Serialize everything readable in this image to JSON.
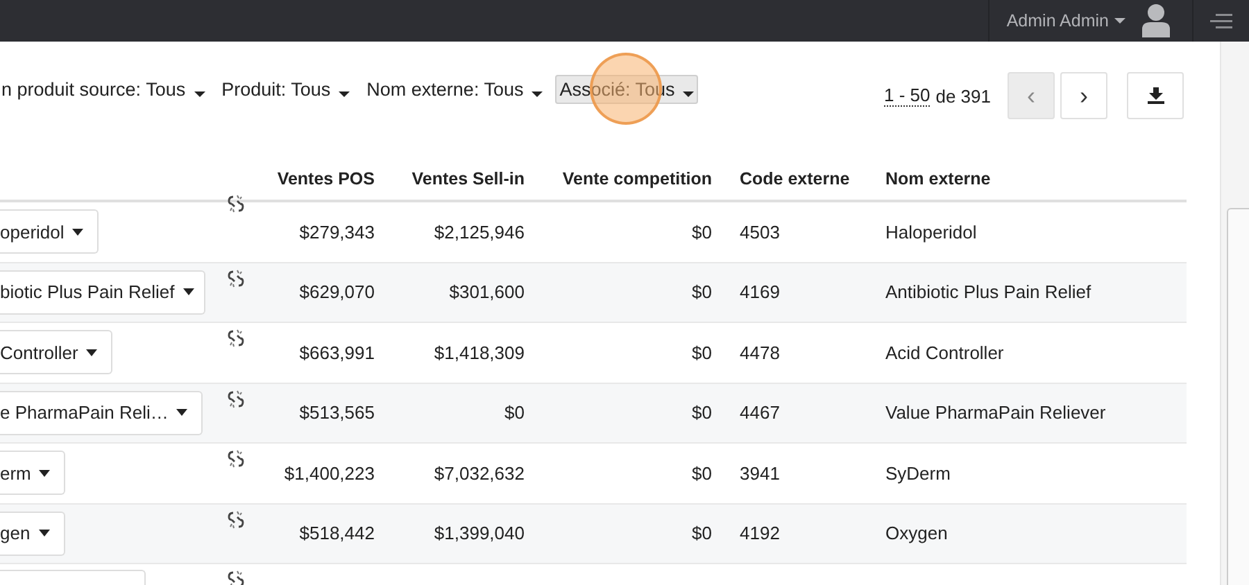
{
  "topbar": {
    "user": "Admin Admin"
  },
  "filters": [
    {
      "label": "n produit source: Tous",
      "highlighted": false
    },
    {
      "label": "Produit: Tous",
      "highlighted": false
    },
    {
      "label": "Nom externe: Tous",
      "highlighted": false
    },
    {
      "label": "Associé: Tous",
      "highlighted": true
    }
  ],
  "pagination": {
    "range": "1 - 50",
    "total": "de 391",
    "prev": "‹",
    "next": "›"
  },
  "table": {
    "columns": [
      "Ventes POS",
      "Ventes Sell-in",
      "Vente competition",
      "Code externe",
      "Nom externe"
    ],
    "rows": [
      {
        "kind": "full",
        "product": "operidol",
        "ventes_pos": "$279,343",
        "ventes_sell_in": "$2,125,946",
        "vente_competition": "$0",
        "code_externe": "4503",
        "nom_externe": "Haloperidol"
      },
      {
        "kind": "full",
        "product": "biotic Plus Pain Relief",
        "ventes_pos": "$629,070",
        "ventes_sell_in": "$301,600",
        "vente_competition": "$0",
        "code_externe": "4169",
        "nom_externe": "Antibiotic Plus Pain Relief"
      },
      {
        "kind": "full",
        "product": "Controller",
        "ventes_pos": "$663,991",
        "ventes_sell_in": "$1,418,309",
        "vente_competition": "$0",
        "code_externe": "4478",
        "nom_externe": "Acid Controller"
      },
      {
        "kind": "full",
        "product": "e PharmaPain Reli…",
        "ventes_pos": "$513,565",
        "ventes_sell_in": "$0",
        "vente_competition": "$0",
        "code_externe": "4467",
        "nom_externe": "Value PharmaPain Reliever"
      },
      {
        "kind": "full",
        "product": "erm",
        "ventes_pos": "$1,400,223",
        "ventes_sell_in": "$7,032,632",
        "vente_competition": "$0",
        "code_externe": "3941",
        "nom_externe": "SyDerm"
      },
      {
        "kind": "full",
        "product": "gen",
        "ventes_pos": "$518,442",
        "ventes_sell_in": "$1,399,040",
        "vente_competition": "$0",
        "code_externe": "4192",
        "nom_externe": "Oxygen"
      },
      {
        "kind": "cut"
      }
    ]
  }
}
